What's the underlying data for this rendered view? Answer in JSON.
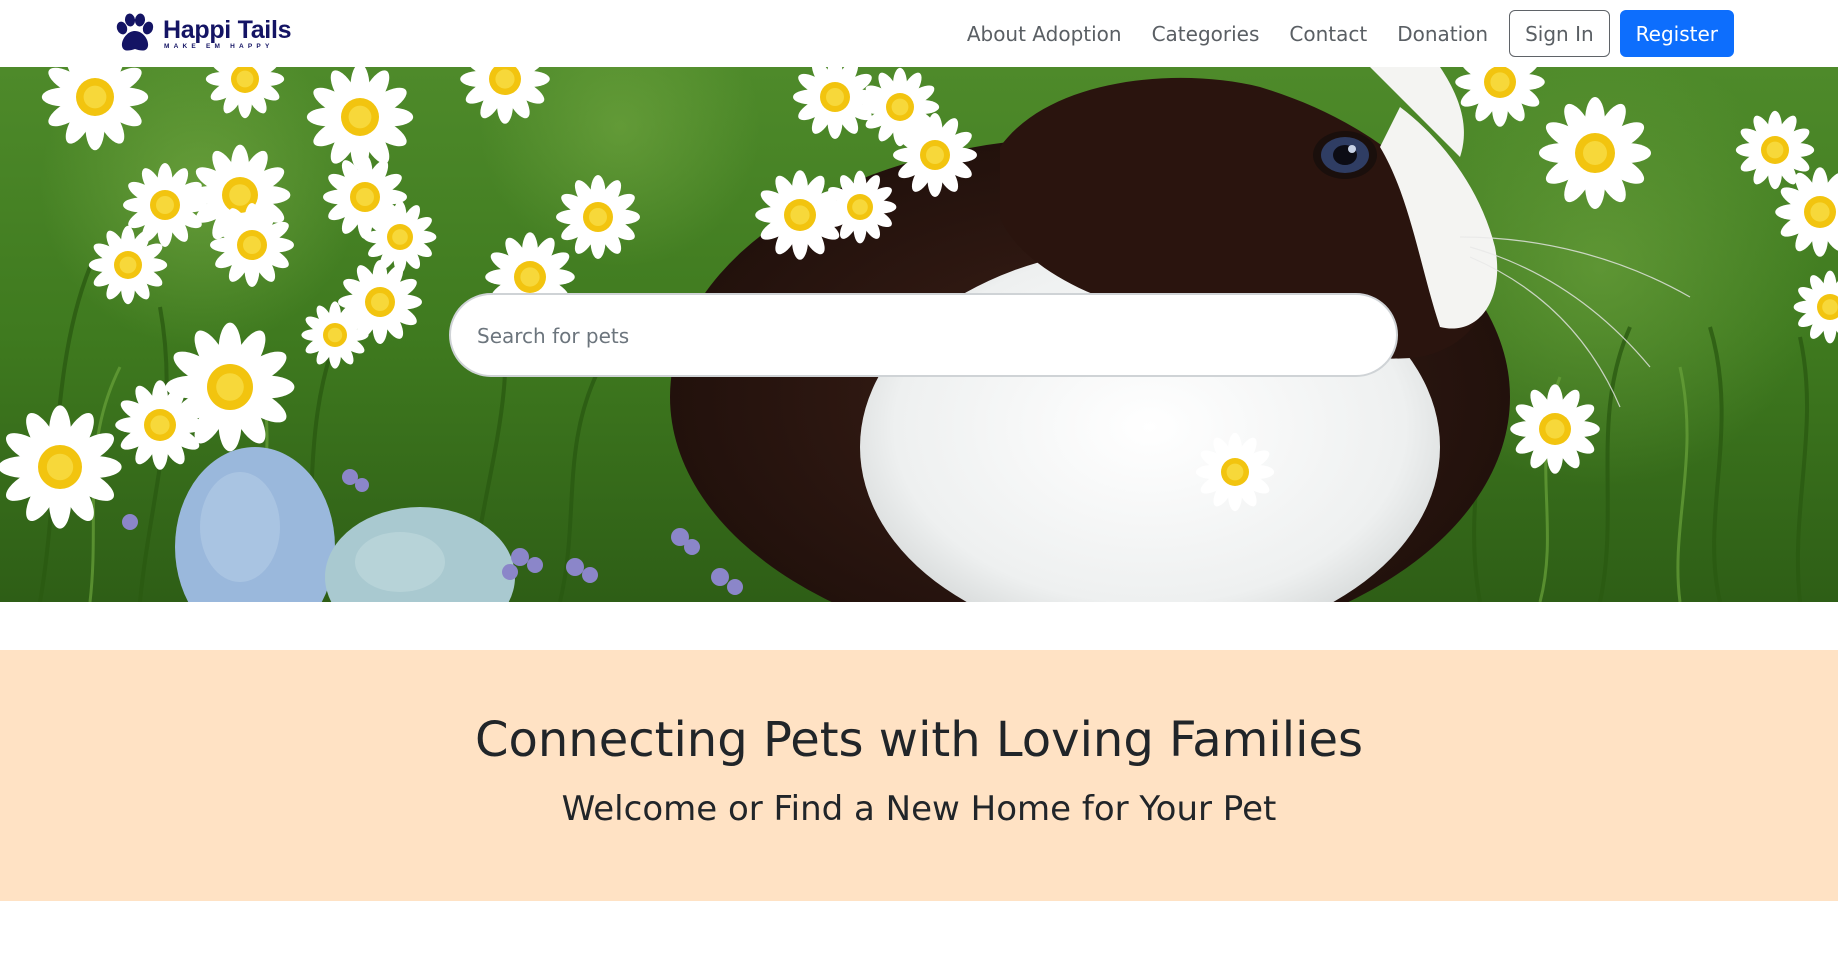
{
  "brand": {
    "name": "Happi Tails",
    "tagline": "MAKE EM HAPPY"
  },
  "nav": {
    "links": [
      {
        "label": "About Adoption"
      },
      {
        "label": "Categories"
      },
      {
        "label": "Contact"
      },
      {
        "label": "Donation"
      }
    ],
    "sign_in_label": "Sign In",
    "register_label": "Register"
  },
  "hero": {
    "search": {
      "placeholder": "Search for pets",
      "value": ""
    }
  },
  "banner": {
    "title": "Connecting Pets with Loving Families",
    "subtitle": "Welcome or Find a New Home for Your Pet"
  },
  "colors": {
    "brand": "#141464",
    "primary": "#0d6efd",
    "banner_bg": "#ffe2c4",
    "nav_text": "#5a5f64"
  }
}
